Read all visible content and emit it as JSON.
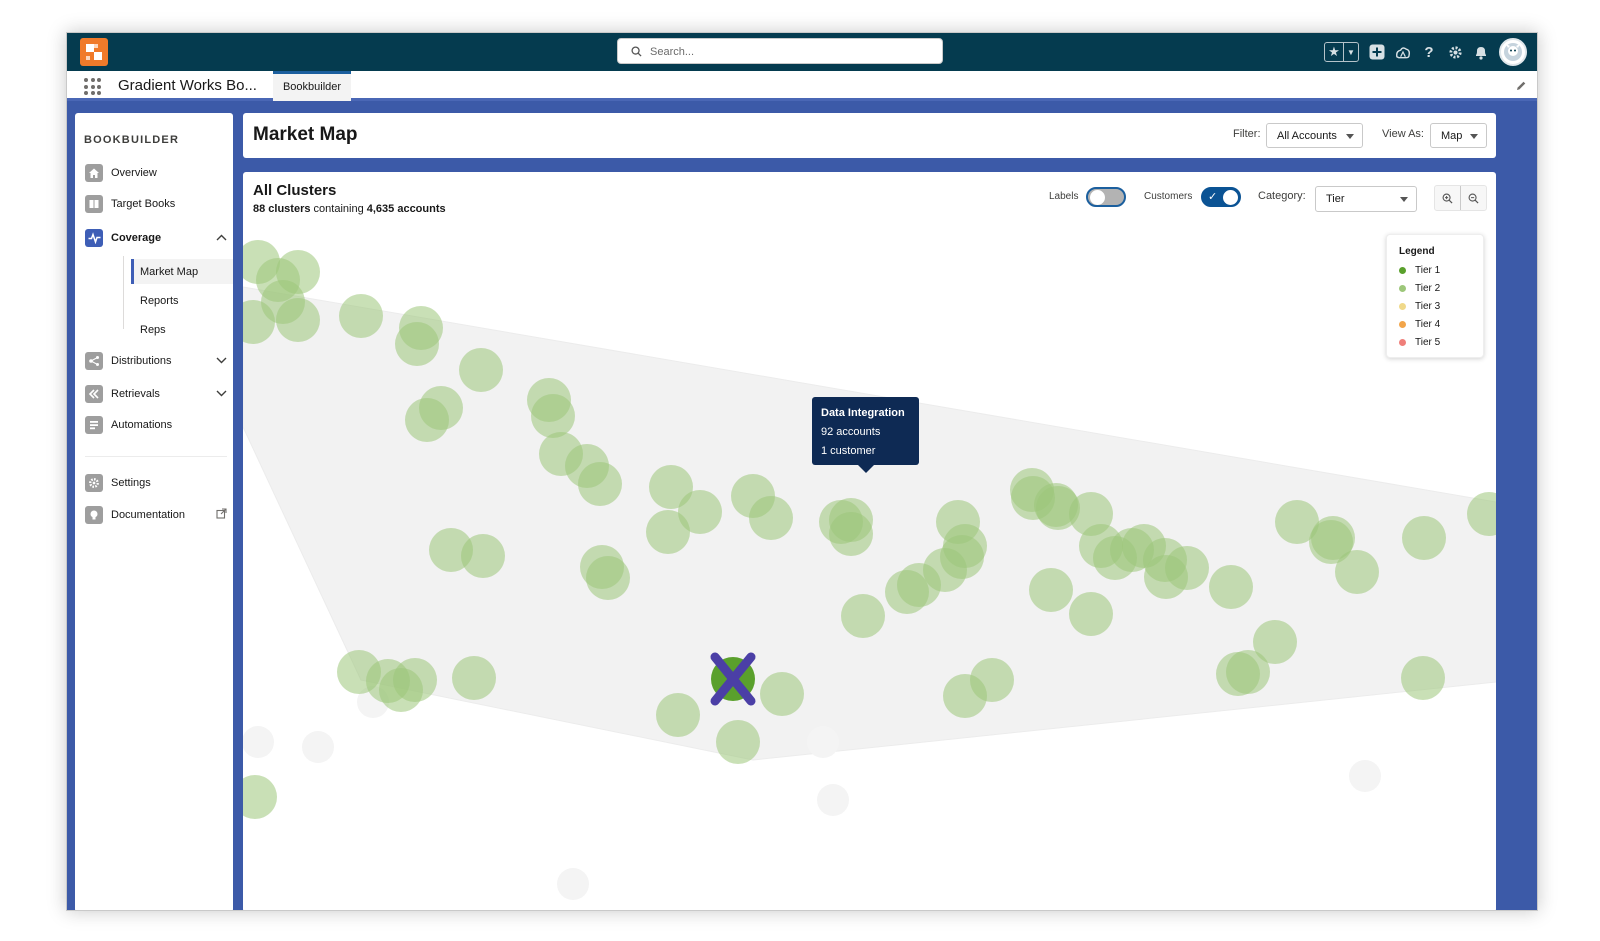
{
  "topbar": {
    "search_placeholder": "Search...",
    "icons": [
      "app-logo",
      "search-icon",
      "favorites-star-icon",
      "favorites-dropdown-icon",
      "global-actions-plus-icon",
      "trailhead-icon",
      "help-icon",
      "setup-gear-icon",
      "notifications-bell-icon",
      "user-avatar"
    ]
  },
  "app_nav": {
    "app_name": "Gradient Works Bo...",
    "tabs": [
      {
        "label": "Bookbuilder",
        "active": true
      }
    ],
    "edit_icon": "pencil-icon"
  },
  "sidebar": {
    "title": "BOOKBUILDER",
    "items": [
      {
        "label": "Overview",
        "icon": "home-icon"
      },
      {
        "label": "Target Books",
        "icon": "book-icon"
      },
      {
        "label": "Coverage",
        "icon": "pulse-icon",
        "active": true,
        "expanded": true,
        "children": [
          {
            "label": "Market Map",
            "active": true
          },
          {
            "label": "Reports"
          },
          {
            "label": "Reps"
          }
        ]
      },
      {
        "label": "Distributions",
        "icon": "distribute-icon"
      },
      {
        "label": "Retrievals",
        "icon": "retrieve-icon"
      },
      {
        "label": "Automations",
        "icon": "automation-icon"
      },
      {
        "label": "Settings",
        "icon": "settings-icon"
      },
      {
        "label": "Documentation",
        "icon": "lightbulb-icon",
        "external": true
      }
    ]
  },
  "header": {
    "title": "Market Map",
    "filter_label": "Filter:",
    "filter_value": "All Accounts",
    "view_as_label": "View As:",
    "view_as_value": "Map"
  },
  "map_panel": {
    "title": "All Clusters",
    "subtitle_clusters": "88 clusters",
    "subtitle_mid": " containing ",
    "subtitle_accounts": "4,635 accounts",
    "labels_toggle": {
      "label": "Labels",
      "on": false
    },
    "customers_toggle": {
      "label": "Customers",
      "on": true
    },
    "category_label": "Category:",
    "category_value": "Tier"
  },
  "legend": {
    "title": "Legend",
    "items": [
      {
        "label": "Tier 1",
        "color": "#5aa02c"
      },
      {
        "label": "Tier 2",
        "color": "#9dc77a"
      },
      {
        "label": "Tier 3",
        "color": "#f0d98a"
      },
      {
        "label": "Tier 4",
        "color": "#f2a54a"
      },
      {
        "label": "Tier 5",
        "color": "#ef7f7a"
      }
    ]
  },
  "tooltip": {
    "title": "Data Integration",
    "accounts": "92 accounts",
    "customers": "1 customer"
  },
  "colors": {
    "topbar": "#053b4f",
    "brand_band": "#3c5aa8",
    "cluster_fill": "#9dc77a",
    "selected_marker": "#4b3fa6",
    "tooltip_bg": "#0e2a54"
  }
}
